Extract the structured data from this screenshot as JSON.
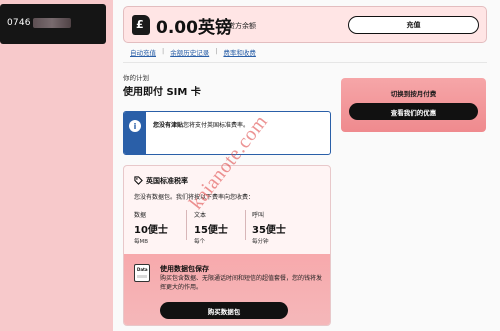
{
  "account": {
    "phone_number": "0746"
  },
  "balance": {
    "amount": "0.00英镑",
    "label": "贷方余额",
    "topup_button": "充值",
    "sim_icon_letter": "£"
  },
  "links": [
    "自动充值",
    "余额历史记录",
    "费率和收费"
  ],
  "plan": {
    "section_label": "你的计划",
    "title": "使用即付 SIM 卡"
  },
  "promo": {
    "title": "切换到按月付费",
    "button": "查看我们的优惠"
  },
  "info": {
    "icon": "i",
    "bold_text": "您没有津贴",
    "text": "您将支付英国标准费率。"
  },
  "rates": {
    "title": "英国标准税率",
    "description": "您没有数据包。我们将按以下费率向您收费：",
    "items": [
      {
        "label": "数据",
        "value": "10便士",
        "unit": "每MB"
      },
      {
        "label": "文本",
        "value": "15便士",
        "unit": "每个"
      },
      {
        "label": "呼叫",
        "value": "35便士",
        "unit": "每分钟"
      }
    ]
  },
  "bundle": {
    "icon_label": "Data",
    "title": "使用数据包保存",
    "description": "购买包含数据、无限通话时间和短信的超值套餐，您的钱将发挥更大的作用。",
    "button": "购买数据包"
  },
  "watermark": "kaianote.com",
  "colors": {
    "sidebar": "#f7c9cb",
    "accent_pink": "#ef8a8e",
    "link_blue": "#2a5fa8",
    "button_dark": "#111111"
  }
}
